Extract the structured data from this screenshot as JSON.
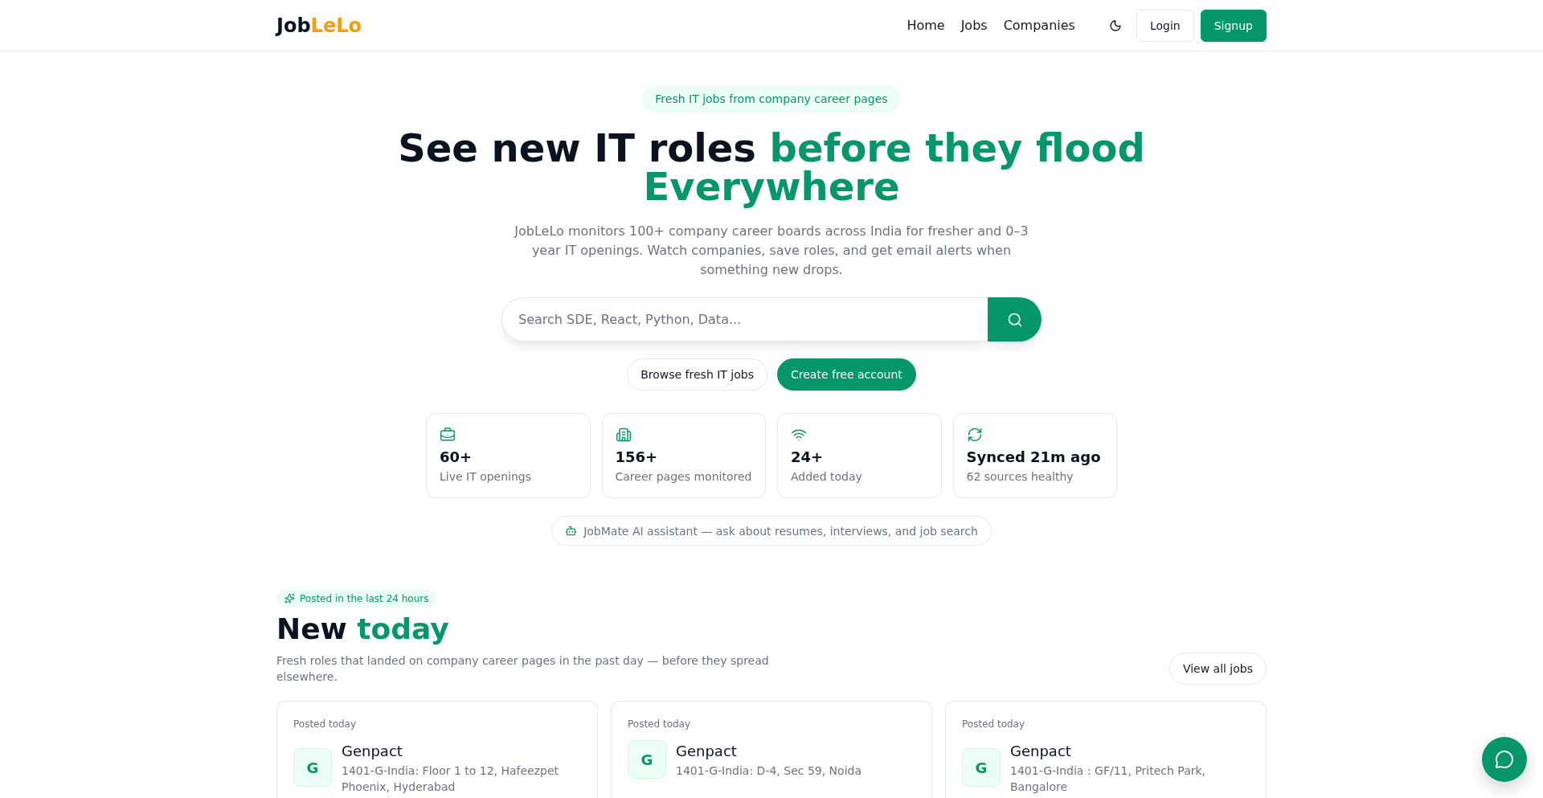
{
  "header": {
    "logo": {
      "text": "Job",
      "accent": "LeLo"
    },
    "nav": [
      {
        "label": "Home"
      },
      {
        "label": "Jobs"
      },
      {
        "label": "Companies"
      }
    ],
    "buttons": [
      {
        "label": "Login",
        "kind": "outline"
      },
      {
        "label": "Signup",
        "kind": "primary"
      }
    ]
  },
  "hero": {
    "badge": "Fresh IT jobs from company career pages",
    "title": {
      "text": "See new IT roles",
      "accent": "before they flood Everywhere"
    },
    "description": "JobLeLo monitors 100+ company career boards across India for fresher and 0–3 year IT openings. Watch companies, save roles, and get email alerts when something new drops.",
    "search": {
      "placeholder": "Search SDE, React, Python, Data..."
    },
    "actions": [
      {
        "label": "Browse fresh IT jobs",
        "kind": "outline"
      },
      {
        "label": "Create free account",
        "kind": "primary"
      }
    ],
    "stats": [
      {
        "value": "60+",
        "label": "Live IT openings"
      },
      {
        "value": "156+",
        "label": "Career pages monitored"
      },
      {
        "value": "24+",
        "label": "Added today"
      },
      {
        "value": "Synced 21m ago",
        "label": "62 sources healthy"
      }
    ],
    "assistant_link": "JobMate AI assistant — ask about resumes, interviews, and job search"
  },
  "new_today": {
    "badge": "Posted in the last 24 hours",
    "title": {
      "text": "New",
      "accent": "today"
    },
    "description": "Fresh roles that landed on company career pages in the past day — before they spread elsewhere.",
    "view_all": "View all jobs",
    "jobs": [
      {
        "posted": "Posted today",
        "initial": "G",
        "company": "Genpact",
        "location": "1401-G-India: Floor 1 to 12, Hafeezpet Phoenix, Hyderabad"
      },
      {
        "posted": "Posted today",
        "initial": "G",
        "company": "Genpact",
        "location": "1401-G-India: D-4, Sec 59, Noida"
      },
      {
        "posted": "Posted today",
        "initial": "G",
        "company": "Genpact",
        "location": "1401-G-India : GF/11, Pritech Park, Bangalore"
      }
    ]
  }
}
